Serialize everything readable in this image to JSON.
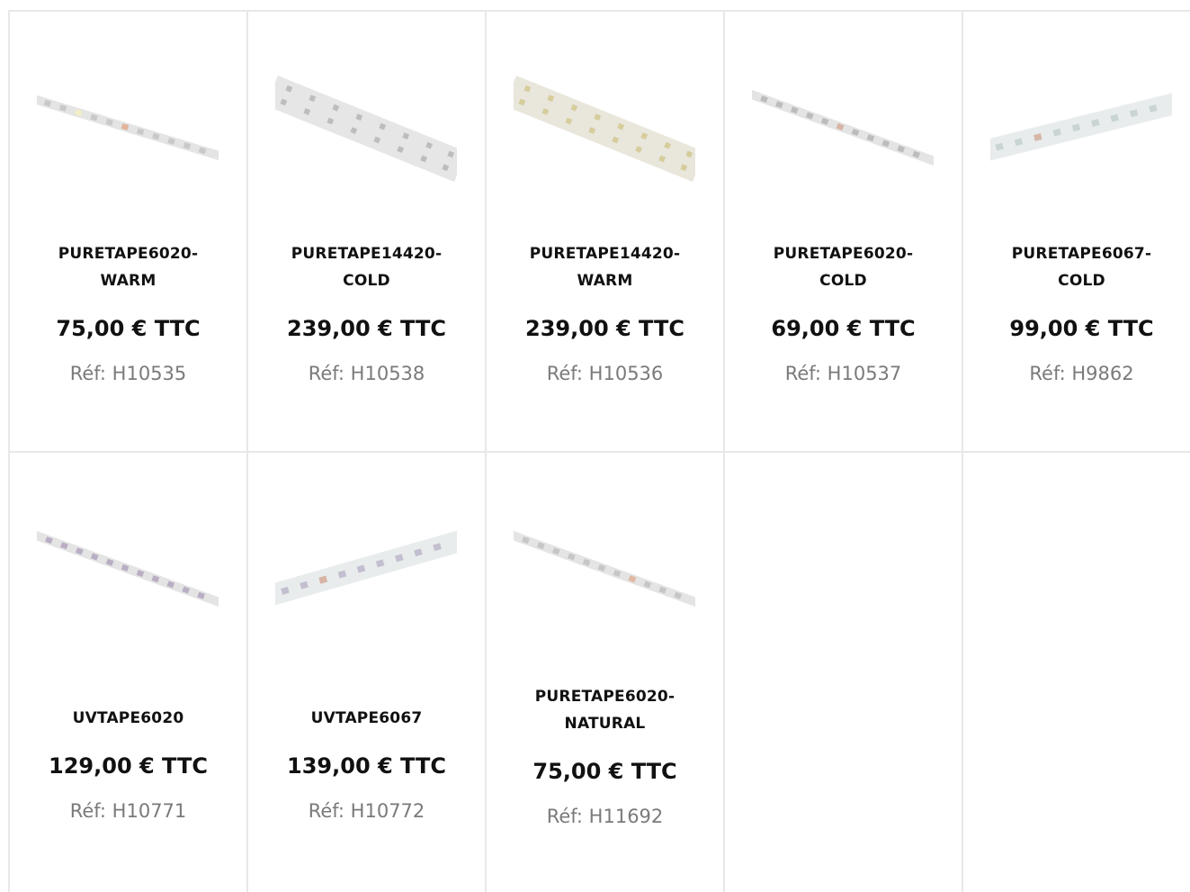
{
  "products": [
    {
      "name_line1": "PURETAPE6020-",
      "name_line2": "WARM",
      "price": "75,00 € TTC",
      "ref": "Réf: H10535",
      "image": "led-strip-single-row"
    },
    {
      "name_line1": "PURETAPE14420-",
      "name_line2": "COLD",
      "price": "239,00 € TTC",
      "ref": "Réf: H10538",
      "image": "led-strip-double-row"
    },
    {
      "name_line1": "PURETAPE14420-",
      "name_line2": "WARM",
      "price": "239,00 € TTC",
      "ref": "Réf: H10536",
      "image": "led-strip-double-row-warm"
    },
    {
      "name_line1": "PURETAPE6020-",
      "name_line2": "COLD",
      "price": "69,00 € TTC",
      "ref": "Réf: H10537",
      "image": "led-strip-single-row"
    },
    {
      "name_line1": "PURETAPE6067-",
      "name_line2": "COLD",
      "price": "99,00 € TTC",
      "ref": "Réf: H9862",
      "image": "led-strip-wide"
    },
    {
      "name_line1": "UVTAPE6020",
      "name_line2": "",
      "price": "129,00 € TTC",
      "ref": "Réf: H10771",
      "image": "led-strip-uv"
    },
    {
      "name_line1": "UVTAPE6067",
      "name_line2": "",
      "price": "139,00 € TTC",
      "ref": "Réf: H10772",
      "image": "led-strip-wide-uv"
    },
    {
      "name_line1": "PURETAPE6020-",
      "name_line2": "NATURAL",
      "price": "75,00 € TTC",
      "ref": "Réf: H11692",
      "image": "led-strip-single-row"
    }
  ],
  "colors": {
    "border": "#e8e8e8",
    "text": "#111111",
    "ref_text": "#7a7a7a"
  }
}
